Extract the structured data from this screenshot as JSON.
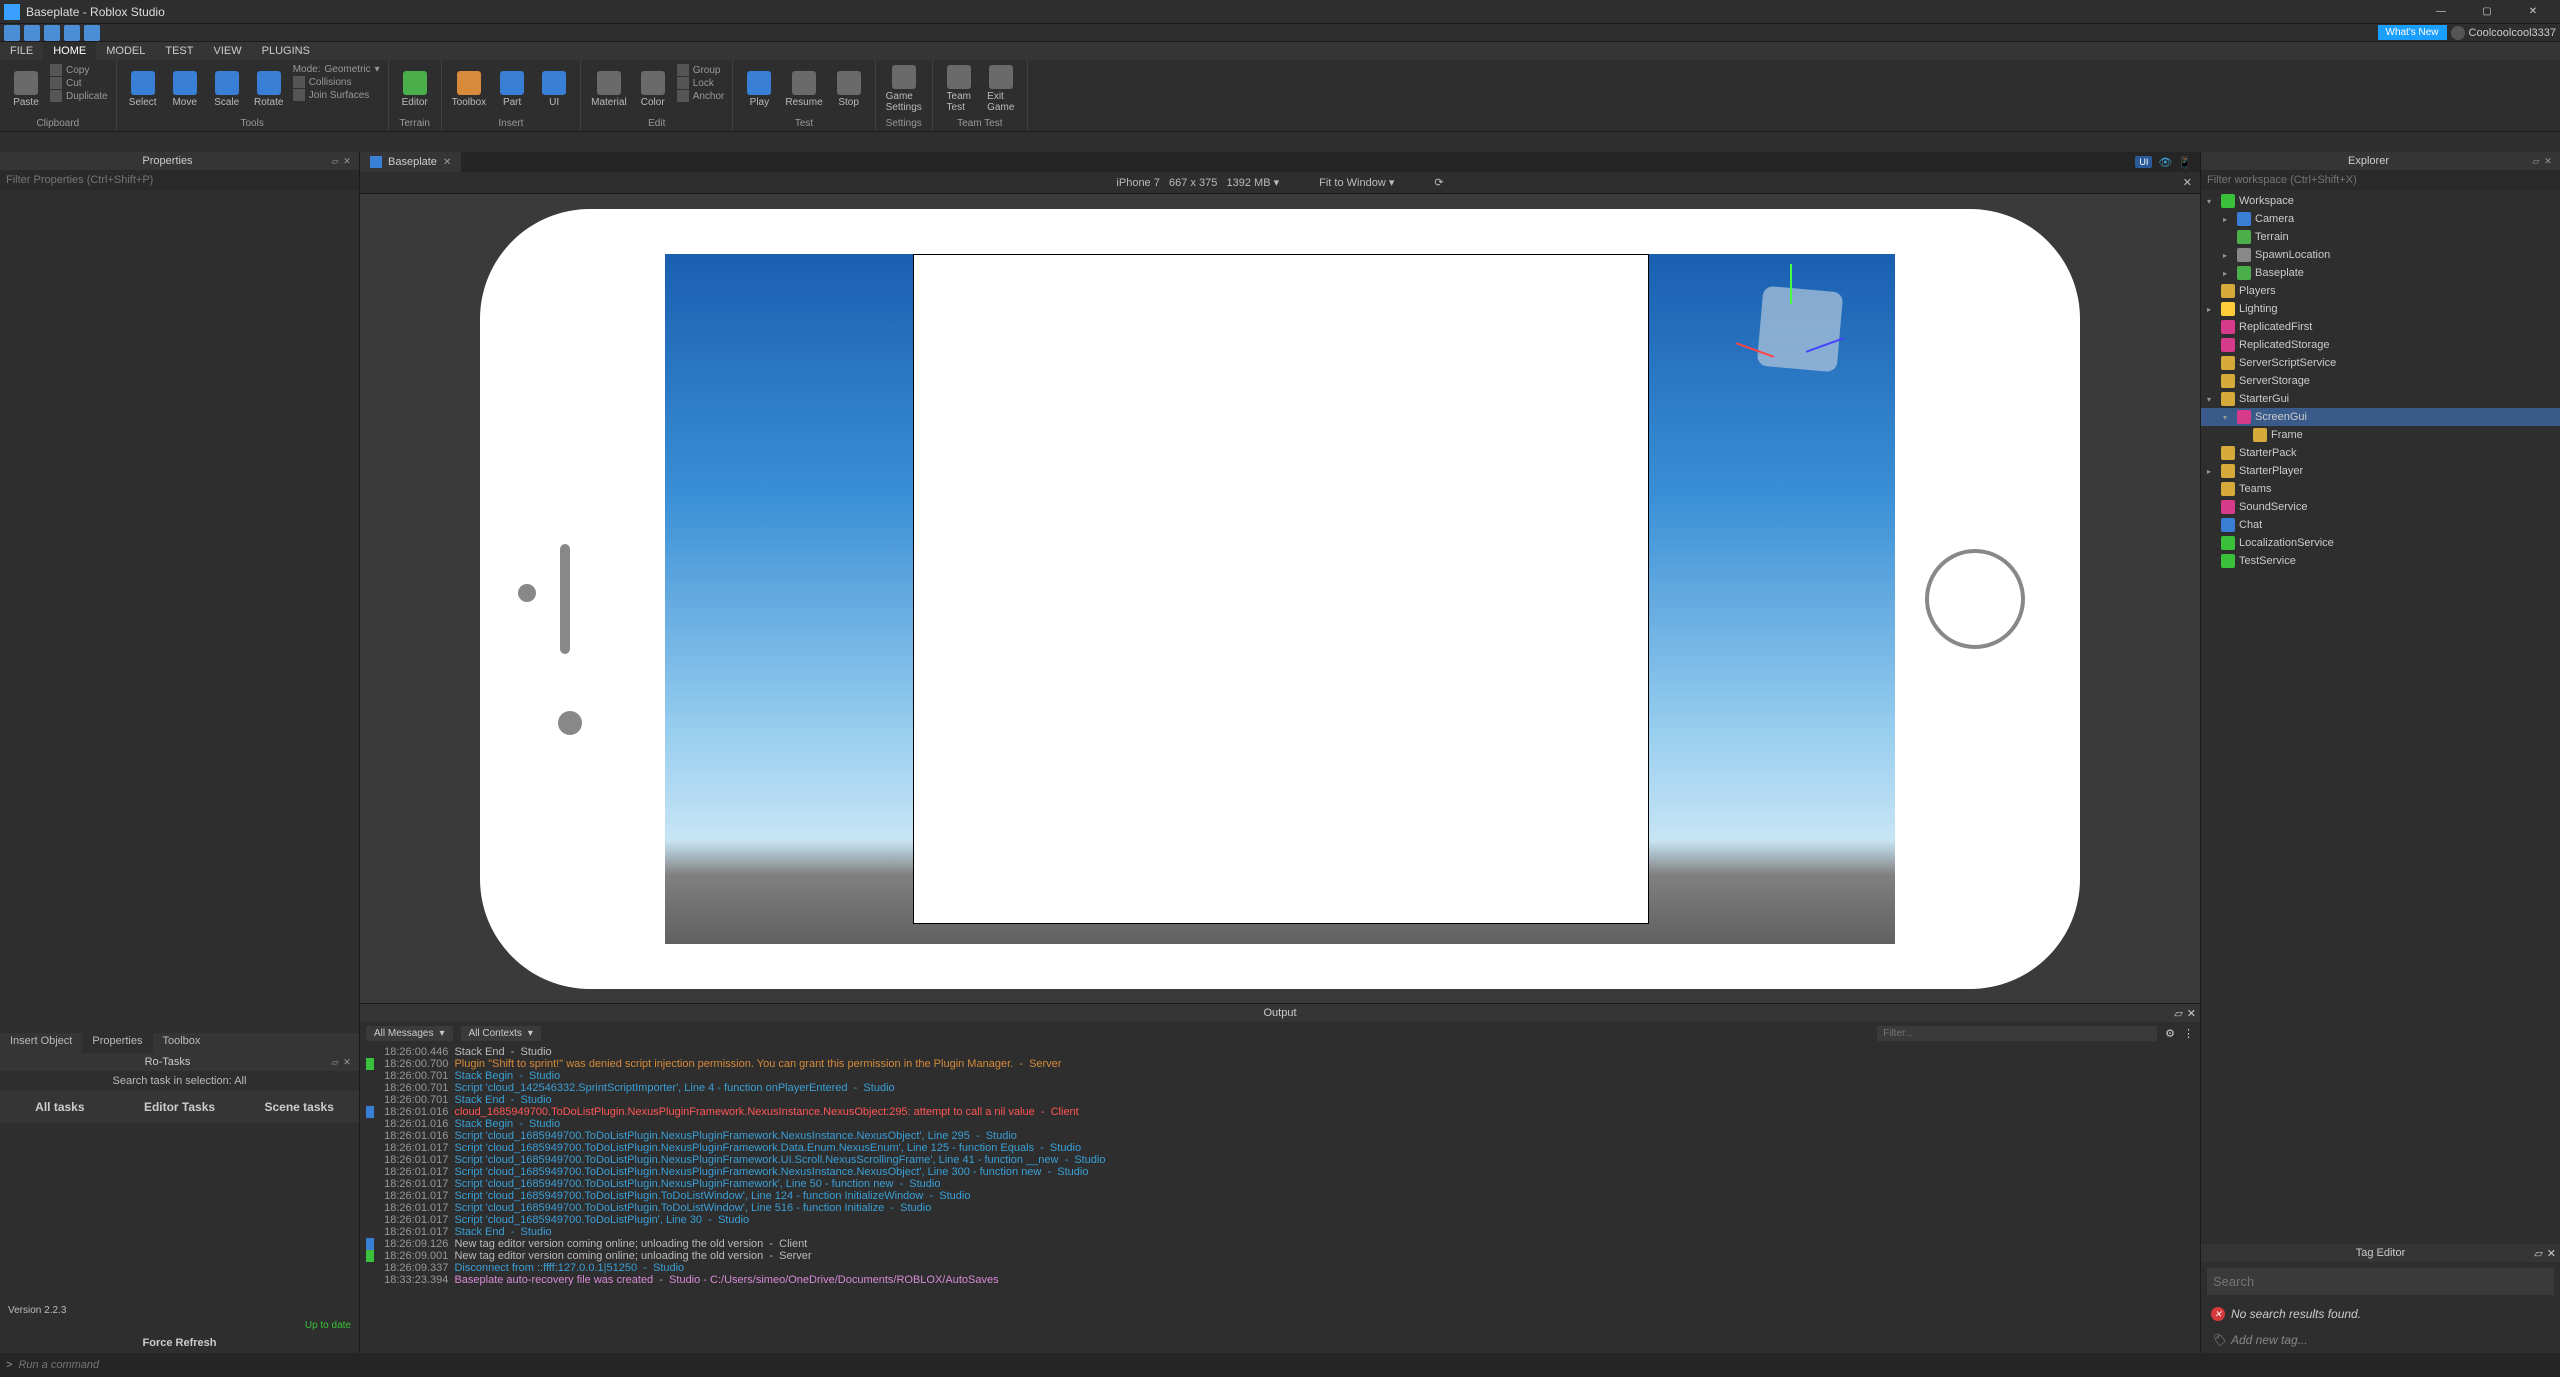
{
  "window": {
    "title": "Baseplate - Roblox Studio"
  },
  "quickbar": {
    "whats_new": "What's New",
    "username": "Coolcoolcool3337"
  },
  "menus": [
    "FILE",
    "HOME",
    "MODEL",
    "TEST",
    "VIEW",
    "PLUGINS"
  ],
  "menu_active": 1,
  "ribbon": {
    "clipboard": {
      "label": "Clipboard",
      "copy": "Copy",
      "cut": "Cut",
      "paste": "Paste",
      "duplicate": "Duplicate"
    },
    "tools": {
      "label": "Tools",
      "select": "Select",
      "move": "Move",
      "scale": "Scale",
      "rotate": "Rotate",
      "mode": "Mode:",
      "mode_val": "Geometric",
      "collisions": "Collisions",
      "join": "Join Surfaces"
    },
    "terrain": {
      "label": "Terrain",
      "editor": "Editor"
    },
    "insert": {
      "label": "Insert",
      "toolbox": "Toolbox",
      "part": "Part",
      "ui": "UI",
      "material": "Material",
      "color": "Color",
      "group": "Group",
      "lock": "Lock",
      "anchor": "Anchor"
    },
    "edit": {
      "label": "Edit"
    },
    "test": {
      "label": "Test",
      "play": "Play",
      "resume": "Resume",
      "stop": "Stop"
    },
    "settings": {
      "label": "Settings",
      "game": "Game\nSettings"
    },
    "teamtest": {
      "label": "Team Test",
      "team": "Team\nTest",
      "exit": "Exit\nGame"
    }
  },
  "doctab": {
    "name": "Baseplate"
  },
  "viewportbar": {
    "device": "iPhone 7",
    "res": "667 x 375",
    "memory": "1392 MB",
    "fit": "Fit to Window",
    "ui_badge": "UI"
  },
  "properties": {
    "title": "Properties",
    "filter_ph": "Filter Properties (Ctrl+Shift+P)",
    "tabs": [
      "Insert Object",
      "Properties",
      "Toolbox"
    ]
  },
  "rotasks": {
    "title": "Ro-Tasks",
    "search": "Search task in selection: All",
    "tabs": [
      "All tasks",
      "Editor Tasks",
      "Scene tasks"
    ],
    "version": "Version 2.2.3",
    "uptodate": "Up to date",
    "force": "Force Refresh"
  },
  "output": {
    "title": "Output",
    "dd1": "All Messages",
    "dd2": "All Contexts",
    "filter_ph": "Filter...",
    "lines": [
      {
        "t": "18:26:00.446",
        "m": "Stack End  -  Studio",
        "c": "",
        "g": ""
      },
      {
        "t": "18:26:00.700",
        "m": "Plugin \"Shift to sprint!\" was denied script injection permission. You can grant this permission in the Plugin Manager.  -  Server",
        "c": "warn",
        "g": "g-green"
      },
      {
        "t": "18:26:00.701",
        "m": "Stack Begin  -  Studio",
        "c": "info",
        "g": ""
      },
      {
        "t": "18:26:00.701",
        "m": "Script 'cloud_142546332.SprintScriptImporter', Line 4 - function onPlayerEntered  -  Studio",
        "c": "info",
        "g": ""
      },
      {
        "t": "18:26:00.701",
        "m": "Stack End  -  Studio",
        "c": "info",
        "g": ""
      },
      {
        "t": "18:26:01.016",
        "m": "cloud_1685949700.ToDoListPlugin.NexusPluginFramework.NexusInstance.NexusObject:295: attempt to call a nil value  -  Client",
        "c": "err",
        "g": "g-blue"
      },
      {
        "t": "18:26:01.016",
        "m": "Stack Begin  -  Studio",
        "c": "info",
        "g": ""
      },
      {
        "t": "18:26:01.016",
        "m": "Script 'cloud_1685949700.ToDoListPlugin.NexusPluginFramework.NexusInstance.NexusObject', Line 295  -  Studio",
        "c": "info",
        "g": ""
      },
      {
        "t": "18:26:01.017",
        "m": "Script 'cloud_1685949700.ToDoListPlugin.NexusPluginFramework.Data.Enum.NexusEnum', Line 125 - function Equals  -  Studio",
        "c": "info",
        "g": ""
      },
      {
        "t": "18:26:01.017",
        "m": "Script 'cloud_1685949700.ToDoListPlugin.NexusPluginFramework.UI.Scroll.NexusScrollingFrame', Line 41 - function __new  -  Studio",
        "c": "info",
        "g": ""
      },
      {
        "t": "18:26:01.017",
        "m": "Script 'cloud_1685949700.ToDoListPlugin.NexusPluginFramework.NexusInstance.NexusObject', Line 300 - function new  -  Studio",
        "c": "info",
        "g": ""
      },
      {
        "t": "18:26:01.017",
        "m": "Script 'cloud_1685949700.ToDoListPlugin.NexusPluginFramework', Line 50 - function new  -  Studio",
        "c": "info",
        "g": ""
      },
      {
        "t": "18:26:01.017",
        "m": "Script 'cloud_1685949700.ToDoListPlugin.ToDoListWindow', Line 124 - function InitializeWindow  -  Studio",
        "c": "info",
        "g": ""
      },
      {
        "t": "18:26:01.017",
        "m": "Script 'cloud_1685949700.ToDoListPlugin.ToDoListWindow', Line 516 - function Initialize  -  Studio",
        "c": "info",
        "g": ""
      },
      {
        "t": "18:26:01.017",
        "m": "Script 'cloud_1685949700.ToDoListPlugin', Line 30  -  Studio",
        "c": "info",
        "g": ""
      },
      {
        "t": "18:26:01.017",
        "m": "Stack End  -  Studio",
        "c": "info",
        "g": ""
      },
      {
        "t": "18:26:09.126",
        "m": "New tag editor version coming online; unloading the old version  -  Client",
        "c": "",
        "g": "g-blue"
      },
      {
        "t": "18:26:09.001",
        "m": "New tag editor version coming online; unloading the old version  -  Server",
        "c": "",
        "g": "g-green"
      },
      {
        "t": "18:26:09.337",
        "m": "Disconnect from ::ffff:127.0.0.1|51250  -  Studio",
        "c": "info",
        "g": ""
      },
      {
        "t": "18:33:23.394",
        "m": "Baseplate auto-recovery file was created  -  Studio - C:/Users/simeo/OneDrive/Documents/ROBLOX/AutoSaves",
        "c": "ok",
        "g": ""
      }
    ]
  },
  "explorer": {
    "title": "Explorer",
    "filter_ph": "Filter workspace (Ctrl+Shift+X)",
    "tree": [
      {
        "d": 0,
        "a": "v",
        "i": "ic-workspace",
        "n": "Workspace"
      },
      {
        "d": 1,
        "a": ">",
        "i": "ic-camera",
        "n": "Camera"
      },
      {
        "d": 1,
        "a": "",
        "i": "ic-terrain",
        "n": "Terrain"
      },
      {
        "d": 1,
        "a": ">",
        "i": "ic-spawn",
        "n": "SpawnLocation"
      },
      {
        "d": 1,
        "a": ">",
        "i": "ic-baseplate",
        "n": "Baseplate"
      },
      {
        "d": 0,
        "a": "",
        "i": "ic-players",
        "n": "Players"
      },
      {
        "d": 0,
        "a": ">",
        "i": "ic-lighting",
        "n": "Lighting"
      },
      {
        "d": 0,
        "a": "",
        "i": "ic-rep",
        "n": "ReplicatedFirst"
      },
      {
        "d": 0,
        "a": "",
        "i": "ic-rep",
        "n": "ReplicatedStorage"
      },
      {
        "d": 0,
        "a": "",
        "i": "ic-storage",
        "n": "ServerScriptService"
      },
      {
        "d": 0,
        "a": "",
        "i": "ic-storage",
        "n": "ServerStorage"
      },
      {
        "d": 0,
        "a": "v",
        "i": "ic-gui",
        "n": "StarterGui"
      },
      {
        "d": 1,
        "a": "v",
        "i": "ic-screengui",
        "n": "ScreenGui",
        "sel": true
      },
      {
        "d": 2,
        "a": "",
        "i": "ic-frame",
        "n": "Frame"
      },
      {
        "d": 0,
        "a": "",
        "i": "ic-pack",
        "n": "StarterPack"
      },
      {
        "d": 0,
        "a": ">",
        "i": "ic-pack",
        "n": "StarterPlayer"
      },
      {
        "d": 0,
        "a": "",
        "i": "ic-teams",
        "n": "Teams"
      },
      {
        "d": 0,
        "a": "",
        "i": "ic-sound",
        "n": "SoundService"
      },
      {
        "d": 0,
        "a": "",
        "i": "ic-chat",
        "n": "Chat"
      },
      {
        "d": 0,
        "a": "",
        "i": "ic-local",
        "n": "LocalizationService"
      },
      {
        "d": 0,
        "a": "",
        "i": "ic-test",
        "n": "TestService"
      }
    ]
  },
  "tageditor": {
    "title": "Tag Editor",
    "search_ph": "Search",
    "no_results": "No search results found.",
    "add": "Add new tag..."
  },
  "commandbar": {
    "ph": "Run a command"
  }
}
